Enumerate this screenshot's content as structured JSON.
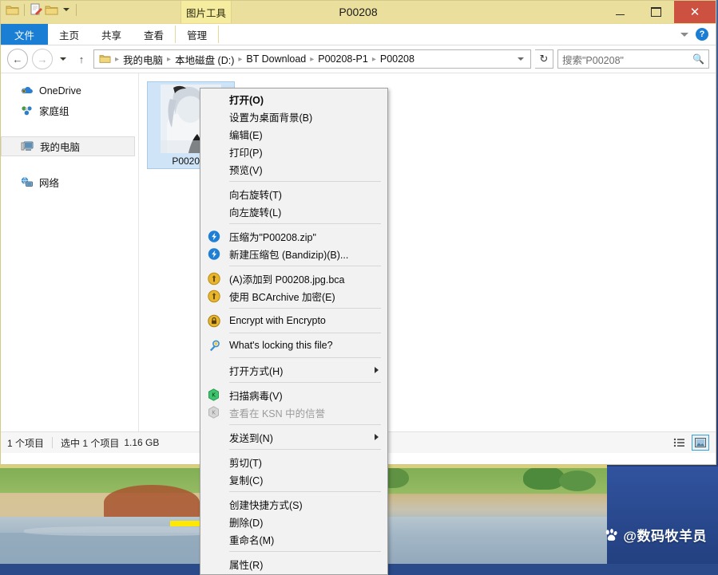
{
  "window": {
    "title": "P00208",
    "contextual_tab_group": "图片工具",
    "quick_access": [
      "folder-icon",
      "new-folder-properties-icon",
      "folder-icon",
      "chevron-down-icon"
    ],
    "controls": {
      "minimize": "–",
      "maximize": "▢",
      "close": "✕"
    }
  },
  "ribbon": {
    "tabs": [
      {
        "label": "文件",
        "active": true
      },
      {
        "label": "主页",
        "active": false
      },
      {
        "label": "共享",
        "active": false
      },
      {
        "label": "查看",
        "active": false
      },
      {
        "label": "管理",
        "active": false,
        "contextual": true
      }
    ],
    "collapse_icon": "chevron-down-icon",
    "help_label": "?"
  },
  "addressbar": {
    "back": "←",
    "forward": "→",
    "history": "chevron-down-icon",
    "up": "↑",
    "breadcrumbs": [
      "我的电脑",
      "本地磁盘 (D:)",
      "BT Download",
      "P00208-P1",
      "P00208"
    ],
    "separator": "▸",
    "dropdown": "chevron-down-icon",
    "refresh": "↻"
  },
  "search": {
    "placeholder": "搜索\"P00208\"",
    "icon": "search-icon"
  },
  "sidebar": {
    "items": [
      {
        "label": "OneDrive",
        "icon": "onedrive-icon",
        "selected": false
      },
      {
        "label": "家庭组",
        "icon": "homegroup-icon",
        "selected": false
      },
      {
        "label": "我的电脑",
        "icon": "computer-icon",
        "selected": true
      },
      {
        "label": "网络",
        "icon": "network-icon",
        "selected": false
      }
    ]
  },
  "files": [
    {
      "name": "P00208.j",
      "full_name": "P00208.jpg",
      "selected": true
    }
  ],
  "statusbar": {
    "item_count": "1 个项目",
    "selection": "选中 1 个项目",
    "size": "1.16 GB",
    "view_details_icon": "details-view-icon",
    "view_large_icon": "large-icons-view-icon"
  },
  "context_menu": {
    "groups": [
      {
        "items": [
          {
            "label": "打开(O)",
            "bold": true,
            "icon": null,
            "submenu": false,
            "disabled": false
          },
          {
            "label": "设置为桌面背景(B)",
            "bold": false,
            "icon": null,
            "submenu": false,
            "disabled": false
          },
          {
            "label": "编辑(E)",
            "bold": false,
            "icon": null,
            "submenu": false,
            "disabled": false
          },
          {
            "label": "打印(P)",
            "bold": false,
            "icon": null,
            "submenu": false,
            "disabled": false
          },
          {
            "label": "预览(V)",
            "bold": false,
            "icon": null,
            "submenu": false,
            "disabled": false
          }
        ]
      },
      {
        "items": [
          {
            "label": "向右旋转(T)",
            "bold": false,
            "icon": null,
            "submenu": false,
            "disabled": false
          },
          {
            "label": "向左旋转(L)",
            "bold": false,
            "icon": null,
            "submenu": false,
            "disabled": false
          }
        ]
      },
      {
        "items": [
          {
            "label": "压缩为\"P00208.zip\"",
            "bold": false,
            "icon": "bandizip-icon",
            "submenu": false,
            "disabled": false
          },
          {
            "label": "新建压缩包 (Bandizip)(B)...",
            "bold": false,
            "icon": "bandizip-icon",
            "submenu": false,
            "disabled": false
          }
        ]
      },
      {
        "items": [
          {
            "label": "(A)添加到 P00208.jpg.bca",
            "bold": false,
            "icon": "bcarchive-icon",
            "submenu": false,
            "disabled": false
          },
          {
            "label": "使用 BCArchive 加密(E)",
            "bold": false,
            "icon": "bcarchive-icon",
            "submenu": false,
            "disabled": false
          }
        ]
      },
      {
        "items": [
          {
            "label": "Encrypt with Encrypto",
            "bold": false,
            "icon": "encrypto-lock-icon",
            "submenu": false,
            "disabled": false
          }
        ]
      },
      {
        "items": [
          {
            "label": "What's locking this file?",
            "bold": false,
            "icon": "lockhunter-icon",
            "submenu": false,
            "disabled": false
          }
        ]
      },
      {
        "items": [
          {
            "label": "打开方式(H)",
            "bold": false,
            "icon": null,
            "submenu": true,
            "disabled": false
          }
        ]
      },
      {
        "items": [
          {
            "label": "扫描病毒(V)",
            "bold": false,
            "icon": "kaspersky-icon",
            "submenu": false,
            "disabled": false
          },
          {
            "label": "查看在 KSN 中的信誉",
            "bold": false,
            "icon": "kaspersky-disabled-icon",
            "submenu": false,
            "disabled": true
          }
        ]
      },
      {
        "items": [
          {
            "label": "发送到(N)",
            "bold": false,
            "icon": null,
            "submenu": true,
            "disabled": false
          }
        ]
      },
      {
        "items": [
          {
            "label": "剪切(T)",
            "bold": false,
            "icon": null,
            "submenu": false,
            "disabled": false
          },
          {
            "label": "复制(C)",
            "bold": false,
            "icon": null,
            "submenu": false,
            "disabled": false
          }
        ]
      },
      {
        "items": [
          {
            "label": "创建快捷方式(S)",
            "bold": false,
            "icon": null,
            "submenu": false,
            "disabled": false
          },
          {
            "label": "删除(D)",
            "bold": false,
            "icon": null,
            "submenu": false,
            "disabled": false
          },
          {
            "label": "重命名(M)",
            "bold": false,
            "icon": null,
            "submenu": false,
            "disabled": false
          }
        ]
      },
      {
        "items": [
          {
            "label": "属性(R)",
            "bold": false,
            "icon": null,
            "submenu": false,
            "disabled": false
          }
        ]
      }
    ]
  },
  "watermark": {
    "text": "@数码牧羊员",
    "icon": "baidu-paw-icon"
  },
  "colors": {
    "titlebar": "#eadf9c",
    "file_tab": "#1a7fd4",
    "close_button": "#cd5140",
    "selection": "#cfe5f7",
    "menu_bg": "#f2f2f2",
    "highlight_line": "#ffe900",
    "desktop": "#2a4a8a"
  }
}
